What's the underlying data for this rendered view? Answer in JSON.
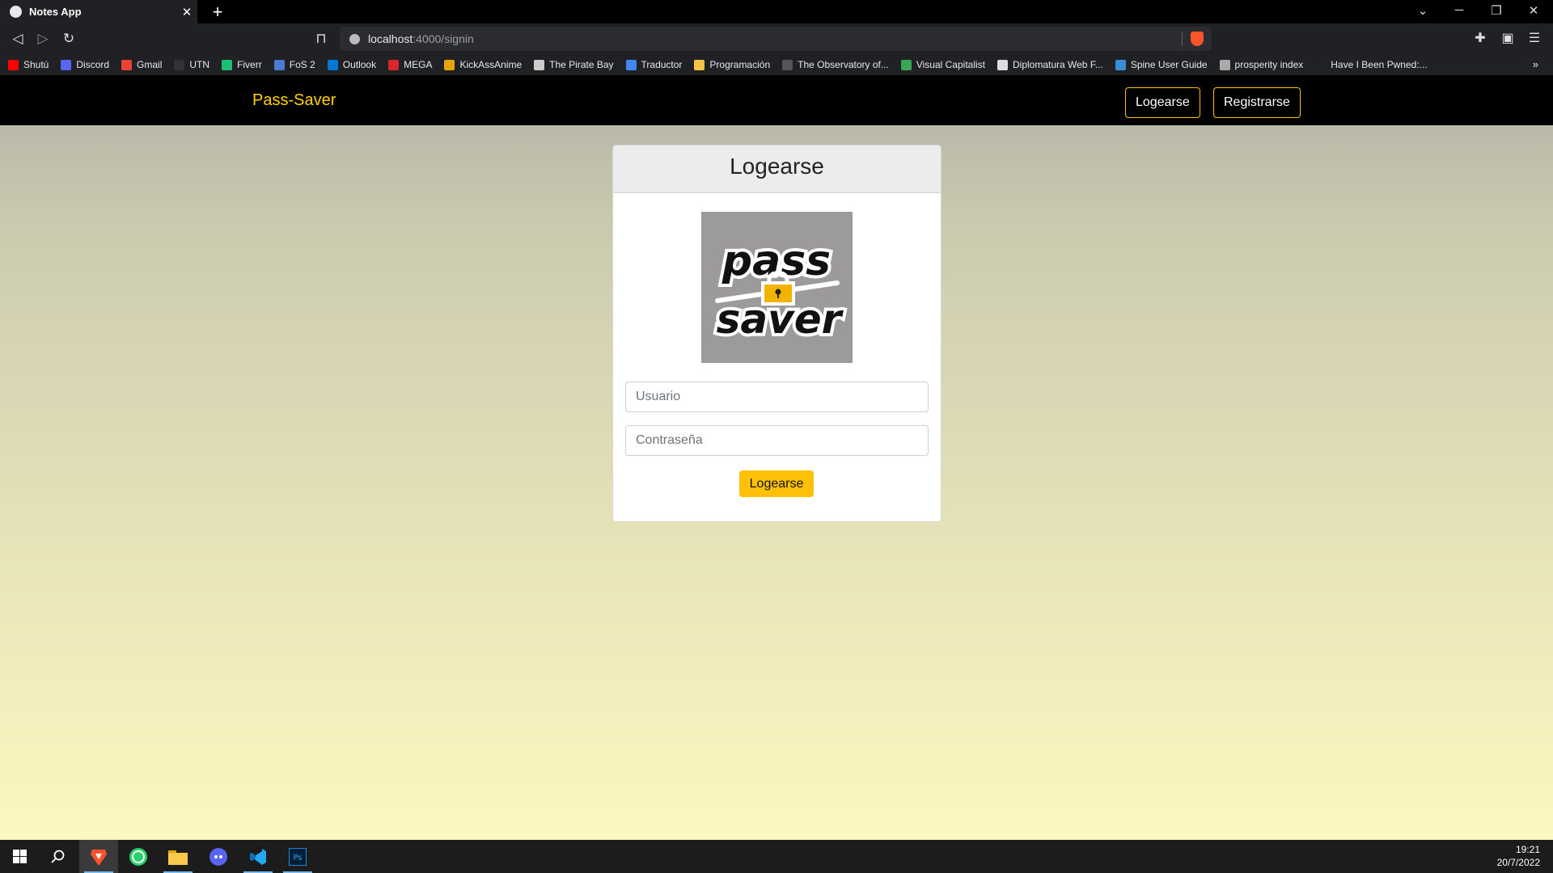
{
  "browser": {
    "tab_title": "Notes App",
    "url_host": "localhost",
    "url_path": ":4000/signin",
    "bookmarks": [
      {
        "label": "Shutú",
        "color": "#ff0000"
      },
      {
        "label": "Discord",
        "color": "#5865f2"
      },
      {
        "label": "Gmail",
        "color": "#ea4335"
      },
      {
        "label": "UTN",
        "color": "#333333"
      },
      {
        "label": "Fiverr",
        "color": "#1dbf73"
      },
      {
        "label": "FoS 2",
        "color": "#4a7bd0"
      },
      {
        "label": "Outlook",
        "color": "#0078d4"
      },
      {
        "label": "MEGA",
        "color": "#d9272e"
      },
      {
        "label": "KickAssAnime",
        "color": "#e5a50a"
      },
      {
        "label": "The Pirate Bay",
        "color": "#cccccc"
      },
      {
        "label": "Traductor",
        "color": "#4285f4"
      },
      {
        "label": "Programación",
        "color": "#f4c542"
      },
      {
        "label": "The Observatory of...",
        "color": "#555555"
      },
      {
        "label": "Visual Capitalist",
        "color": "#3aa655"
      },
      {
        "label": "Diplomatura Web F...",
        "color": "#dddddd"
      },
      {
        "label": "Spine User Guide",
        "color": "#3b8bd6"
      },
      {
        "label": "prosperity index",
        "color": "#aaaaaa"
      },
      {
        "label": "Have I Been Pwned:...",
        "color": "#202124"
      }
    ]
  },
  "app": {
    "brand": "Pass-Saver",
    "nav_login": "Logearse",
    "nav_register": "Registrarse",
    "card_title": "Logearse",
    "logo_line1": "pass",
    "logo_line2": "saver",
    "username_placeholder": "Usuario",
    "password_placeholder": "Contraseña",
    "submit_label": "Logearse",
    "accent_color": "#ffc107"
  },
  "taskbar": {
    "time": "19:21",
    "date": "20/7/2022"
  }
}
